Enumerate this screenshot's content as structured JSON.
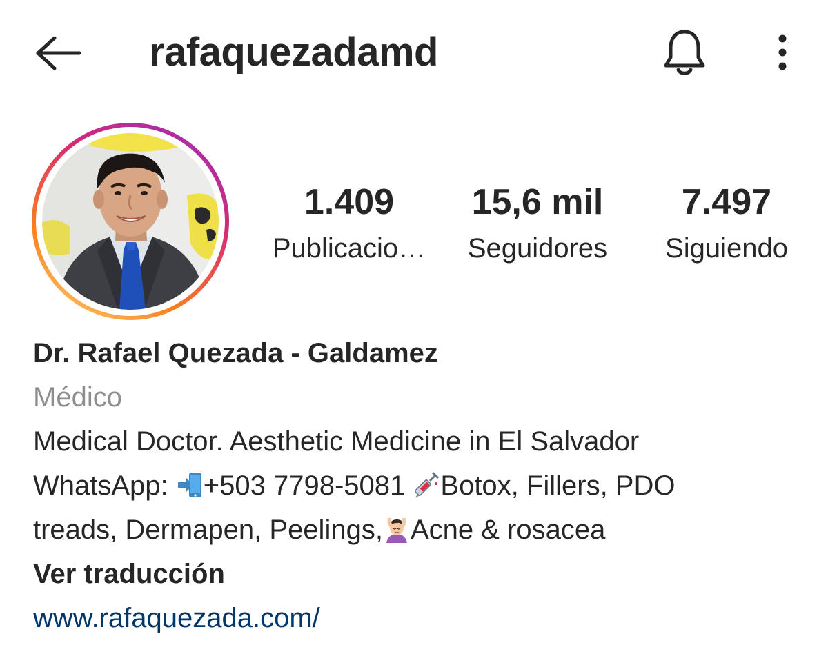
{
  "header": {
    "username": "rafaquezadamd",
    "icons": {
      "back": "arrow-left-icon",
      "notifications": "bell-icon",
      "more": "more-vertical-icon"
    }
  },
  "profile": {
    "avatar_icon": "profile-photo",
    "ring_colors": [
      "#feda75",
      "#fa7e1e",
      "#d62976",
      "#962fbf"
    ]
  },
  "stats": [
    {
      "value": "1.409",
      "label": "Publicacio…"
    },
    {
      "value": "15,6 mil",
      "label": "Seguidores"
    },
    {
      "value": "7.497",
      "label": "Siguiendo"
    }
  ],
  "bio": {
    "full_name": "Dr. Rafael Quezada - Galdamez",
    "category": "Médico",
    "line1": "Medical Doctor. Aesthetic Medicine in El Salvador",
    "line2_prefix": "WhatsApp: ",
    "line2_phone": "+503 7798-5081 ",
    "line2_suffix": "Botox, Fillers,  PDO",
    "line3_prefix": "treads, Dermapen, Peelings,",
    "line3_suffix": "Acne & rosacea",
    "see_translation": "Ver traducción",
    "website": "www.rafaquezada.com/",
    "emoji_icons": [
      "mobile-phone-arrow-icon",
      "syringe-icon",
      "woman-getting-massage-icon"
    ]
  },
  "colors": {
    "text": "#262626",
    "secondary_text": "#8e8e8e",
    "link": "#00376b",
    "background": "#ffffff"
  }
}
